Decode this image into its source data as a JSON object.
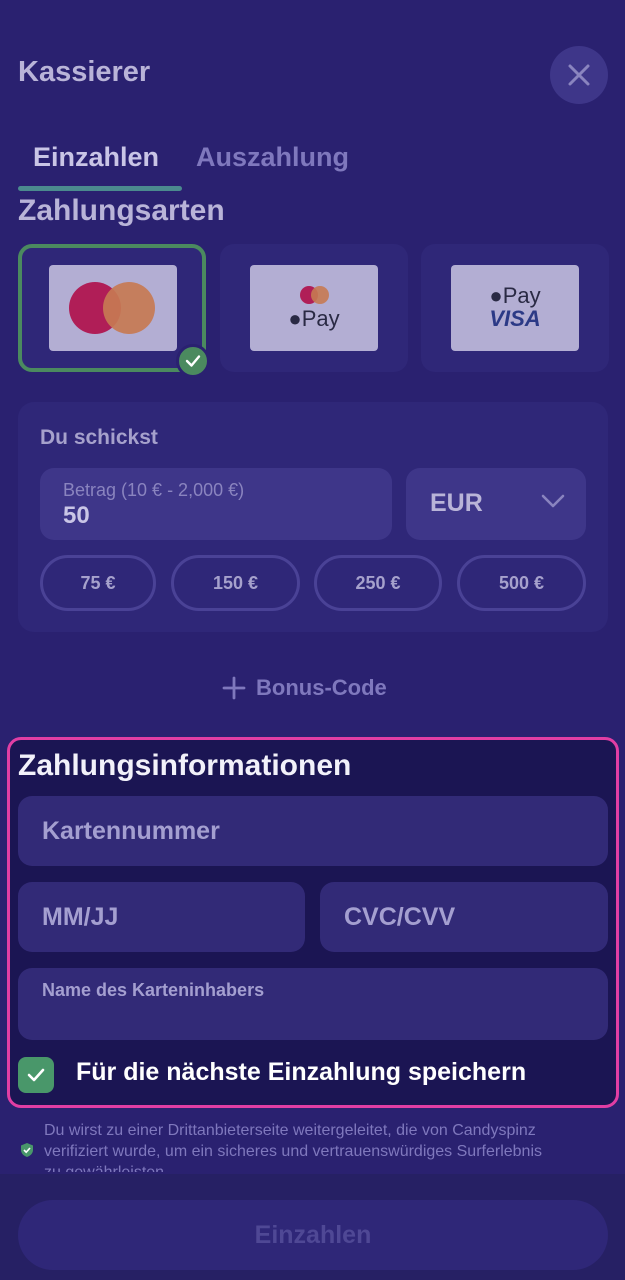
{
  "header": {
    "title": "Kassierer",
    "close_icon": "close-icon"
  },
  "tabs": [
    {
      "label": "Einzahlen",
      "active": true
    },
    {
      "label": "Auszahlung",
      "active": false
    }
  ],
  "payment_methods": {
    "title": "Zahlungsarten",
    "items": [
      {
        "name": "mastercard",
        "selected": true
      },
      {
        "name": "mastercard-apple-pay",
        "line1": "Pay",
        "selected": false
      },
      {
        "name": "apple-pay-visa",
        "line1": "Pay",
        "line2": "VISA",
        "selected": false
      }
    ]
  },
  "send": {
    "label": "Du schickst",
    "amount_label": "Betrag (10 € - 2,000 €)",
    "amount_value": "50",
    "currency": "EUR",
    "chips": [
      "75 €",
      "150 €",
      "250 €",
      "500 €"
    ]
  },
  "bonus": {
    "label": "Bonus-Code"
  },
  "payment_info": {
    "title": "Zahlungsinformationen",
    "card_number_placeholder": "Kartennummer",
    "expiry_placeholder": "MM/JJ",
    "cvc_placeholder": "CVC/CVV",
    "name_label": "Name des Karteninhabers",
    "save_label": "Für die nächste Einzahlung speichern",
    "save_checked": true
  },
  "notice": "Du wirst zu einer Drittanbieterseite weitergeleitet, die von Candyspinz verifiziert wurde, um ein sicheres und vertrauenswürdiges Surferlebnis zu gewährleisten.",
  "footer": {
    "submit_label": "Einzahlen"
  },
  "colors": {
    "background": "#2a2170",
    "highlight_border": "#e13ea4",
    "accent_green": "#49976a"
  }
}
